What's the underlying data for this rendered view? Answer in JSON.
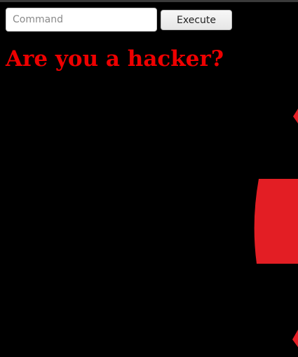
{
  "command": {
    "placeholder": "Command",
    "value": ""
  },
  "execute_button": {
    "label": "Execute"
  },
  "heading": {
    "text": "Are you a hacker?",
    "color": "#ee0000"
  },
  "emblem": {
    "color": "#e31e24",
    "icon": "red-emblem-graphic"
  }
}
